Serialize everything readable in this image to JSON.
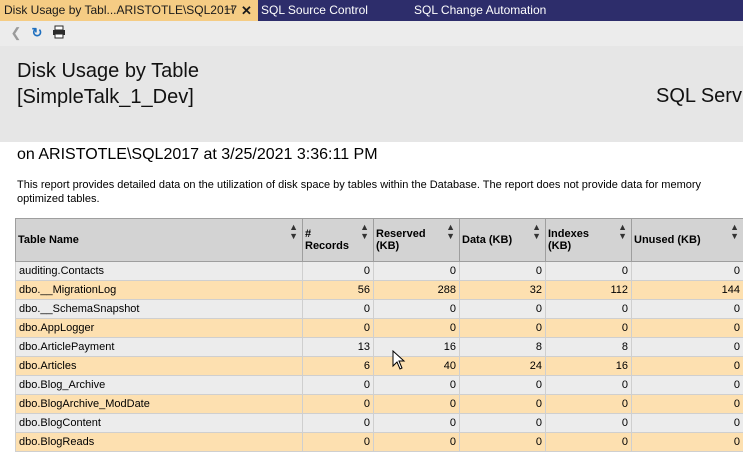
{
  "tabs": [
    {
      "label": "Disk Usage by Tabl...ARISTOTLE\\SQL2017",
      "active": true
    },
    {
      "label": "SQL Source Control",
      "active": false
    },
    {
      "label": "SQL Change Automation",
      "active": false
    }
  ],
  "toolbar": {
    "back_icon": "back-icon",
    "refresh_icon": "refresh-icon",
    "print_icon": "print-icon"
  },
  "report": {
    "title_line1": "Disk Usage by Table",
    "title_line2": "[SimpleTalk_1_Dev]",
    "brand": "SQL Serv",
    "subtitle": "on ARISTOTLE\\SQL2017 at 3/25/2021 3:36:11 PM",
    "description": "This report provides detailed data on the utilization of disk space by tables within the Database. The report does not provide data for memory optimized tables."
  },
  "table": {
    "headers": [
      "Table Name",
      "# Records",
      "Reserved (KB)",
      "Data (KB)",
      "Indexes (KB)",
      "Unused (KB)"
    ],
    "rows": [
      [
        "auditing.Contacts",
        "0",
        "0",
        "0",
        "0",
        "0"
      ],
      [
        "dbo.__MigrationLog",
        "56",
        "288",
        "32",
        "112",
        "144"
      ],
      [
        "dbo.__SchemaSnapshot",
        "0",
        "0",
        "0",
        "0",
        "0"
      ],
      [
        "dbo.AppLogger",
        "0",
        "0",
        "0",
        "0",
        "0"
      ],
      [
        "dbo.ArticlePayment",
        "13",
        "16",
        "8",
        "8",
        "0"
      ],
      [
        "dbo.Articles",
        "6",
        "40",
        "24",
        "16",
        "0"
      ],
      [
        "dbo.Blog_Archive",
        "0",
        "0",
        "0",
        "0",
        "0"
      ],
      [
        "dbo.BlogArchive_ModDate",
        "0",
        "0",
        "0",
        "0",
        "0"
      ],
      [
        "dbo.BlogContent",
        "0",
        "0",
        "0",
        "0",
        "0"
      ],
      [
        "dbo.BlogReads",
        "0",
        "0",
        "0",
        "0",
        "0"
      ]
    ]
  },
  "colors": {
    "tab_bar": "#2d2d6b",
    "active_tab": "#f5cc84",
    "header_band": "#e6e6e6",
    "row_even": "#ececec",
    "row_odd": "#fde0b0",
    "table_header": "#d3d3d3"
  }
}
